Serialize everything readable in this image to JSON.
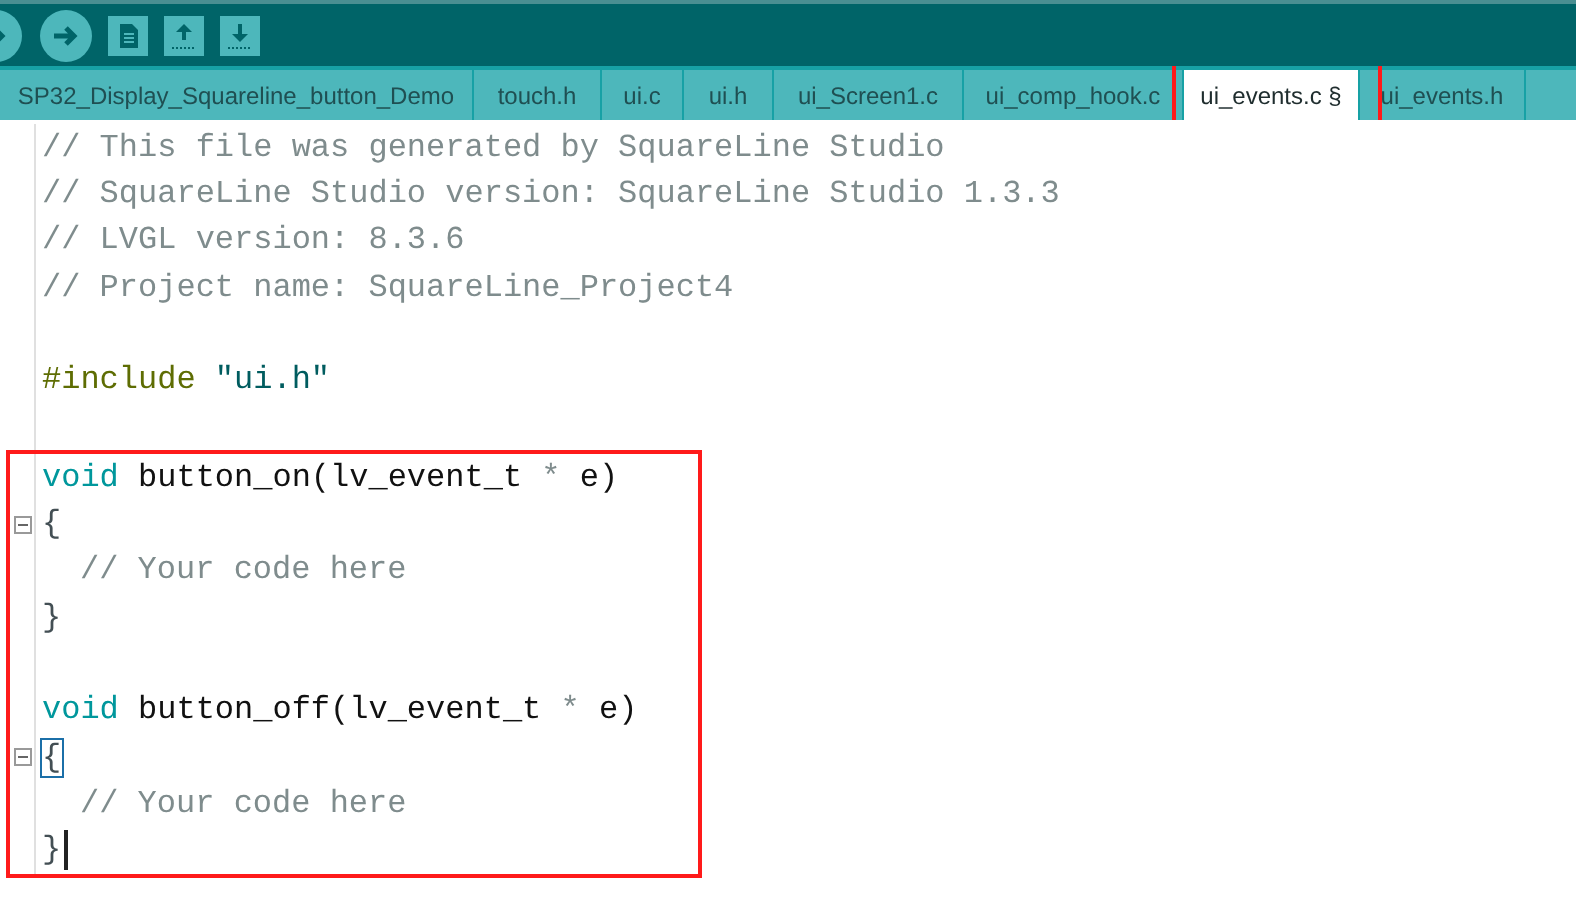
{
  "toolbar": {
    "buttons": [
      {
        "kind": "verify"
      },
      {
        "kind": "upload"
      },
      {
        "kind": "new"
      },
      {
        "kind": "open"
      },
      {
        "kind": "save"
      }
    ]
  },
  "tabs": [
    {
      "label": "SP32_Display_Squareline_button_Demo",
      "selected": false,
      "boxed": false
    },
    {
      "label": "touch.h",
      "selected": false,
      "boxed": false
    },
    {
      "label": "ui.c",
      "selected": false,
      "boxed": false
    },
    {
      "label": "ui.h",
      "selected": false,
      "boxed": false
    },
    {
      "label": "ui_Screen1.c",
      "selected": false,
      "boxed": false
    },
    {
      "label": "ui_comp_hook.c",
      "selected": false,
      "boxed": false
    },
    {
      "label": "ui_events.c §",
      "selected": true,
      "boxed": true
    },
    {
      "label": "ui_events.h",
      "selected": false,
      "boxed": false
    }
  ],
  "code": {
    "blocks": [
      {
        "boxed": false,
        "lines": [
          {
            "fold": false,
            "tokens": [
              {
                "kind": "comment",
                "text": "// This file was generated by SquareLine Studio"
              }
            ]
          },
          {
            "fold": false,
            "tokens": [
              {
                "kind": "comment",
                "text": "// SquareLine Studio version: SquareLine Studio 1.3.3"
              }
            ]
          },
          {
            "fold": false,
            "tokens": [
              {
                "kind": "comment",
                "text": "// LVGL version: 8.3.6"
              }
            ]
          },
          {
            "fold": false,
            "tokens": [
              {
                "kind": "comment",
                "text": "// Project name: SquareLine_Project4"
              }
            ]
          },
          {
            "fold": false
          },
          {
            "fold": false,
            "tokens": [
              {
                "kind": "preprocessor",
                "text": "#include"
              },
              {
                "kind": "string",
                "text": "\"ui.h\"",
                "space_before": true
              }
            ]
          },
          {
            "fold": false
          }
        ]
      },
      {
        "boxed": true,
        "lines": [
          {
            "fold": false,
            "tokens": [
              {
                "kind": "keyword",
                "text": "void"
              },
              {
                "kind": "plain",
                "text": " button_on(lv_event_t "
              },
              {
                "kind": "operator",
                "text": "*"
              },
              {
                "kind": "plain",
                "text": " e)"
              }
            ]
          },
          {
            "fold": true,
            "tokens": [
              {
                "kind": "brace",
                "text": "{"
              }
            ]
          },
          {
            "fold": false,
            "indent": true,
            "tokens": [
              {
                "kind": "comment",
                "text": "// Your code here"
              }
            ]
          },
          {
            "fold": false,
            "tokens": [
              {
                "kind": "brace",
                "text": "}"
              }
            ]
          },
          {
            "fold": false
          },
          {
            "fold": false,
            "tokens": [
              {
                "kind": "keyword",
                "text": "void"
              },
              {
                "kind": "plain",
                "text": " button_off(lv_event_t "
              },
              {
                "kind": "operator",
                "text": "*"
              },
              {
                "kind": "plain",
                "text": " e)"
              }
            ]
          },
          {
            "fold": true,
            "tokens": [
              {
                "kind": "brace_match",
                "text": "{"
              }
            ]
          },
          {
            "fold": false,
            "indent": true,
            "tokens": [
              {
                "kind": "comment",
                "text": "// Your code here"
              }
            ]
          },
          {
            "fold": false,
            "cursor": true,
            "tokens": [
              {
                "kind": "brace",
                "text": "}"
              }
            ]
          }
        ]
      }
    ]
  }
}
